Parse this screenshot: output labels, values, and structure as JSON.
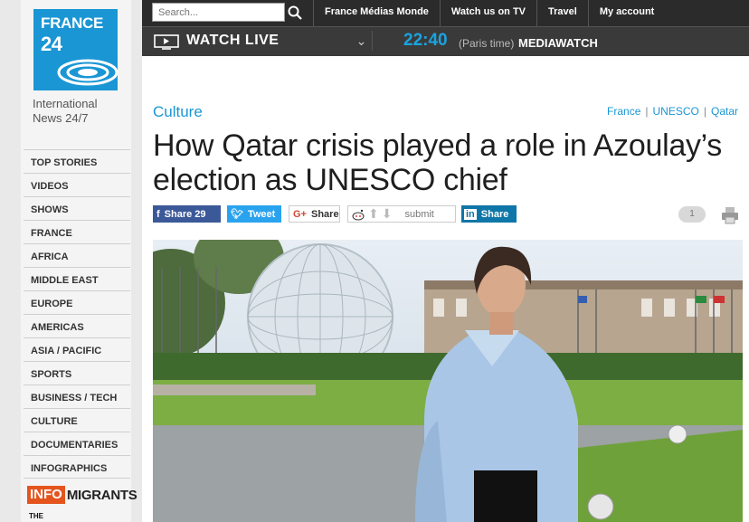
{
  "brand": {
    "logo_line1": "FRANCE",
    "logo_line2": "24",
    "tagline": "International News 24/7"
  },
  "search": {
    "placeholder": "Search..."
  },
  "top_menu": [
    "France Médias Monde",
    "Watch us on TV",
    "Travel",
    "My account"
  ],
  "live": {
    "label": "WATCH LIVE",
    "time": "22:40",
    "timezone": "(Paris time)",
    "program": "MEDIAWATCH"
  },
  "nav": [
    "TOP STORIES",
    "VIDEOS",
    "SHOWS",
    "FRANCE",
    "AFRICA",
    "MIDDLE EAST",
    "EUROPE",
    "AMERICAS",
    "ASIA / PACIFIC",
    "SPORTS",
    "BUSINESS / TECH",
    "CULTURE",
    "DOCUMENTARIES",
    "INFOGRAPHICS"
  ],
  "partners": {
    "infomigrants_a": "INFO",
    "infomigrants_b": "MIGRANTS",
    "observers": "THE"
  },
  "article": {
    "section": "Culture",
    "tags": [
      "France",
      "UNESCO",
      "Qatar"
    ],
    "headline": "How Qatar crisis played a role in Azoulay’s election as UNESCO chief"
  },
  "share": {
    "facebook": "Share 29",
    "twitter": "Tweet",
    "googleplus": "Share",
    "reddit": "submit",
    "linkedin": "Share",
    "comments": "1"
  },
  "colors": {
    "brand_blue": "#1a96d4",
    "topbar": "#2b2b2b",
    "facebook": "#3b5998",
    "twitter": "#2aa3ef",
    "linkedin": "#0e76a8"
  }
}
